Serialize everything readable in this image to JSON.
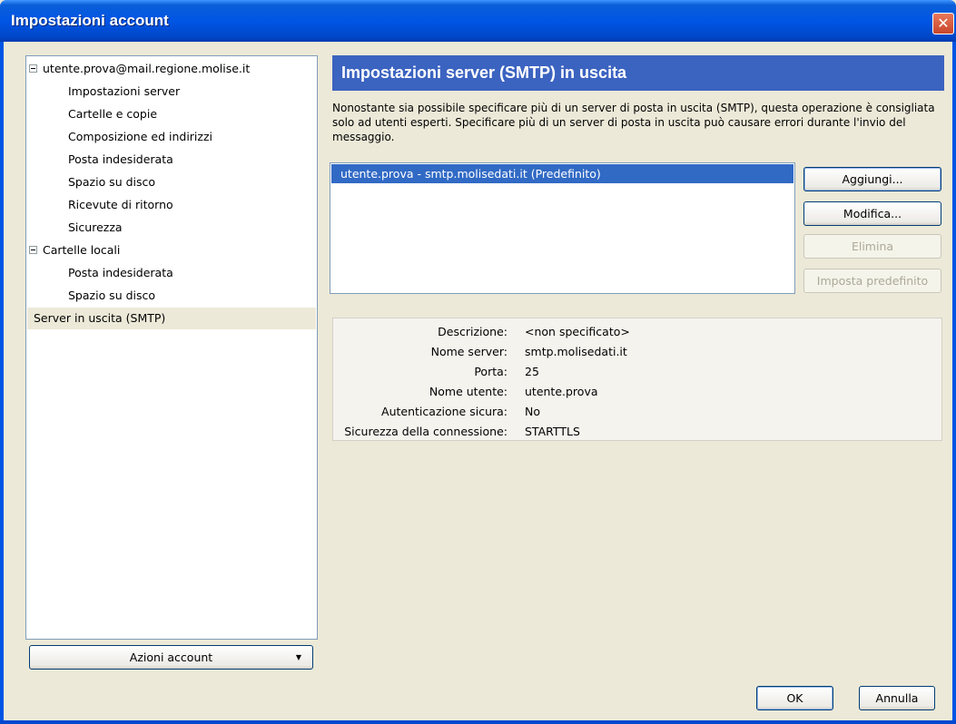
{
  "window": {
    "title": "Impostazioni account",
    "close_glyph": "✕"
  },
  "tree": {
    "items": [
      {
        "label": "utente.prova@mail.regione.molise.it",
        "level": 0,
        "expander": true
      },
      {
        "label": "Impostazioni server",
        "level": 1
      },
      {
        "label": "Cartelle e copie",
        "level": 1
      },
      {
        "label": "Composizione ed indirizzi",
        "level": 1
      },
      {
        "label": "Posta indesiderata",
        "level": 1
      },
      {
        "label": "Spazio su disco",
        "level": 1
      },
      {
        "label": "Ricevute di ritorno",
        "level": 1
      },
      {
        "label": "Sicurezza",
        "level": 1
      },
      {
        "label": "Cartelle locali",
        "level": 0,
        "expander": true
      },
      {
        "label": "Posta indesiderata",
        "level": 1
      },
      {
        "label": "Spazio su disco",
        "level": 1
      },
      {
        "label": "Server in uscita (SMTP)",
        "level": 0,
        "selected": true
      }
    ]
  },
  "account_actions": {
    "label": "Azioni account",
    "arrow": "▼"
  },
  "panel": {
    "title": "Impostazioni server (SMTP) in uscita",
    "description": "Nonostante sia possibile specificare più di un server di posta in uscita (SMTP), questa operazione è consigliata solo ad utenti esperti. Specificare più di un server di posta in uscita può causare errori durante l'invio del messaggio.",
    "servers": [
      {
        "label": "utente.prova - smtp.molisedati.it (Predefinito)",
        "selected": true
      }
    ],
    "buttons": {
      "add": "Aggiungi...",
      "edit": "Modifica...",
      "delete": "Elimina",
      "set_default": "Imposta predefinito"
    },
    "details": [
      {
        "label": "Descrizione:",
        "value": "<non specificato>"
      },
      {
        "label": "Nome server:",
        "value": "smtp.molisedati.it"
      },
      {
        "label": "Porta:",
        "value": "25"
      },
      {
        "label": "Nome utente:",
        "value": "utente.prova"
      },
      {
        "label": "Autenticazione sicura:",
        "value": "No"
      },
      {
        "label": "Sicurezza della connessione:",
        "value": "STARTTLS"
      }
    ]
  },
  "footer": {
    "ok": "OK",
    "cancel": "Annulla"
  },
  "colors": {
    "titlebar": "#0055e5",
    "header_band": "#3b63c0",
    "selection": "#316ac5",
    "dialog_bg": "#ece9d8"
  }
}
